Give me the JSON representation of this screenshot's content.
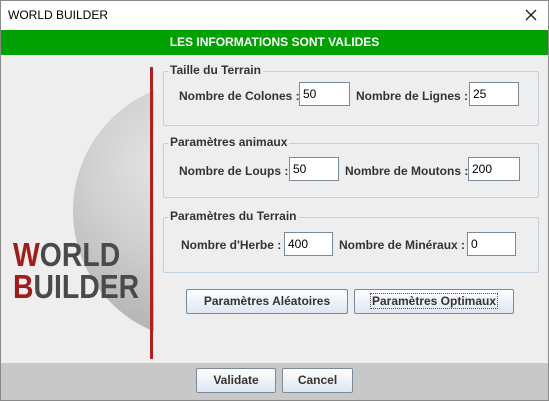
{
  "window": {
    "title": "WORLD BUILDER"
  },
  "banner": {
    "text": "LES INFORMATIONS SONT VALIDES"
  },
  "logo": {
    "line1_first": "W",
    "line1_rest": "ORLD",
    "line2_first": "B",
    "line2_rest": "UILDER"
  },
  "terrain_size": {
    "legend": "Taille du Terrain",
    "columns_label": "Nombre de Colones :",
    "columns_value": "50",
    "rows_label": "Nombre de Lignes :",
    "rows_value": "25"
  },
  "animals": {
    "legend": "Paramètres animaux",
    "wolves_label": "Nombre de Loups :",
    "wolves_value": "50",
    "sheep_label": "Nombre de Moutons :",
    "sheep_value": "200"
  },
  "terrain_params": {
    "legend": "Paramètres du Terrain",
    "grass_label": "Nombre d'Herbe :",
    "grass_value": "400",
    "minerals_label": "Nombre de Minéraux :",
    "minerals_value": "0"
  },
  "buttons": {
    "random": "Paramètres Aléatoires",
    "optimal": "Paramètres Optimaux",
    "validate": "Validate",
    "cancel": "Cancel"
  },
  "colors": {
    "banner": "#00a100",
    "logo_accent": "#a21c1c",
    "logo_text": "#4a4a4a"
  },
  "icons": {
    "close": "close-icon"
  }
}
